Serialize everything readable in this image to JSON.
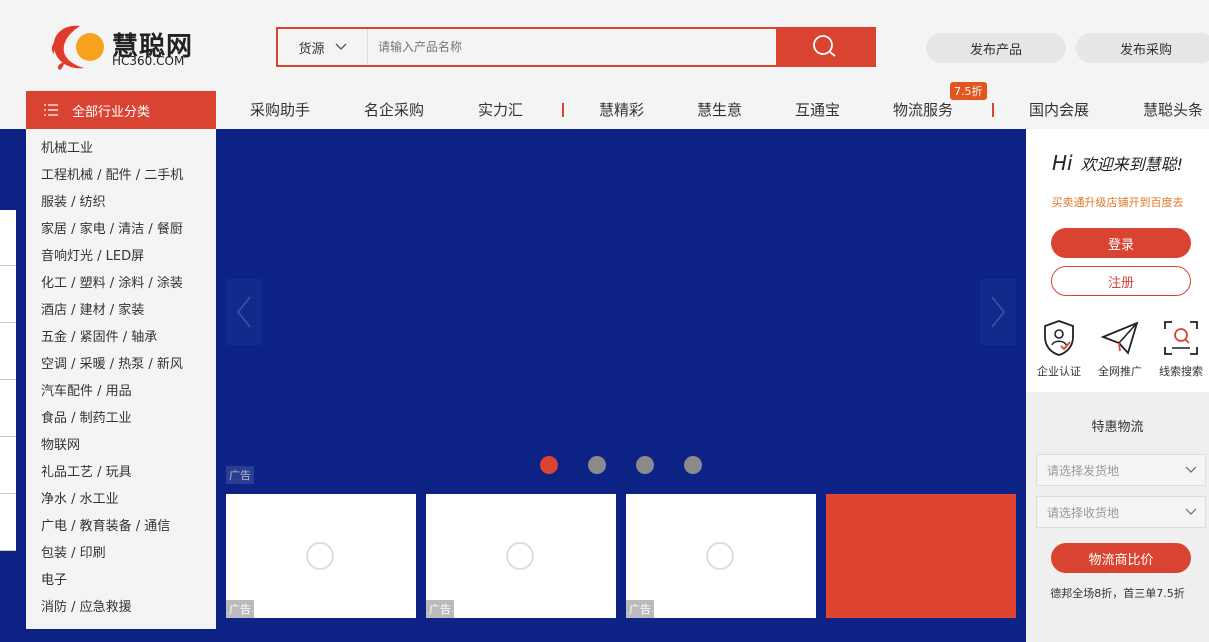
{
  "header": {
    "logo_cn": "慧聪网",
    "logo_en": "HC360.COM",
    "search_type": "货源",
    "search_placeholder": "请输入产品名称",
    "publish_product": "发布产品",
    "publish_purchase": "发布采购"
  },
  "nav": {
    "category_label": "全部行业分类",
    "items": [
      "采购助手",
      "名企采购",
      "实力汇",
      "慧精彩",
      "慧生意",
      "互通宝",
      "物流服务",
      "国内会展",
      "慧聪头条"
    ],
    "badge": "7.5折"
  },
  "categories": [
    "机械工业",
    "工程机械 / 配件 / 二手机",
    "服装 / 纺织",
    "家居 / 家电 / 清洁 / 餐厨",
    "音响灯光 / LED屏",
    "化工 / 塑料 / 涂料 / 涂装",
    "酒店 / 建材 / 家装",
    "五金 / 紧固件 / 轴承",
    "空调 / 采暖 / 热泵 / 新风",
    "汽车配件 / 用品",
    "食品 / 制药工业",
    "物联网",
    "礼品工艺 / 玩具",
    "净水 / 水工业",
    "广电 / 教育装备 / 通信",
    "包装 / 印刷",
    "电子",
    "消防 / 应急救援"
  ],
  "banner": {
    "ad_label": "广告",
    "dots": 4,
    "active_dot": 0
  },
  "right": {
    "hi": "Hi",
    "welcome": "欢迎来到慧聪!",
    "promo": "买卖通升级店铺开到百度去",
    "login": "登录",
    "register": "注册",
    "features": [
      "企业认证",
      "全网推广",
      "线索搜索"
    ],
    "logistics_title": "特惠物流",
    "from_placeholder": "请选择发货地",
    "to_placeholder": "请选择收货地",
    "compare": "物流商比价",
    "note": "德邦全场8折，首三单7.5折"
  },
  "colors": {
    "accent": "#d94432",
    "banner_bg": "#0c2385"
  }
}
